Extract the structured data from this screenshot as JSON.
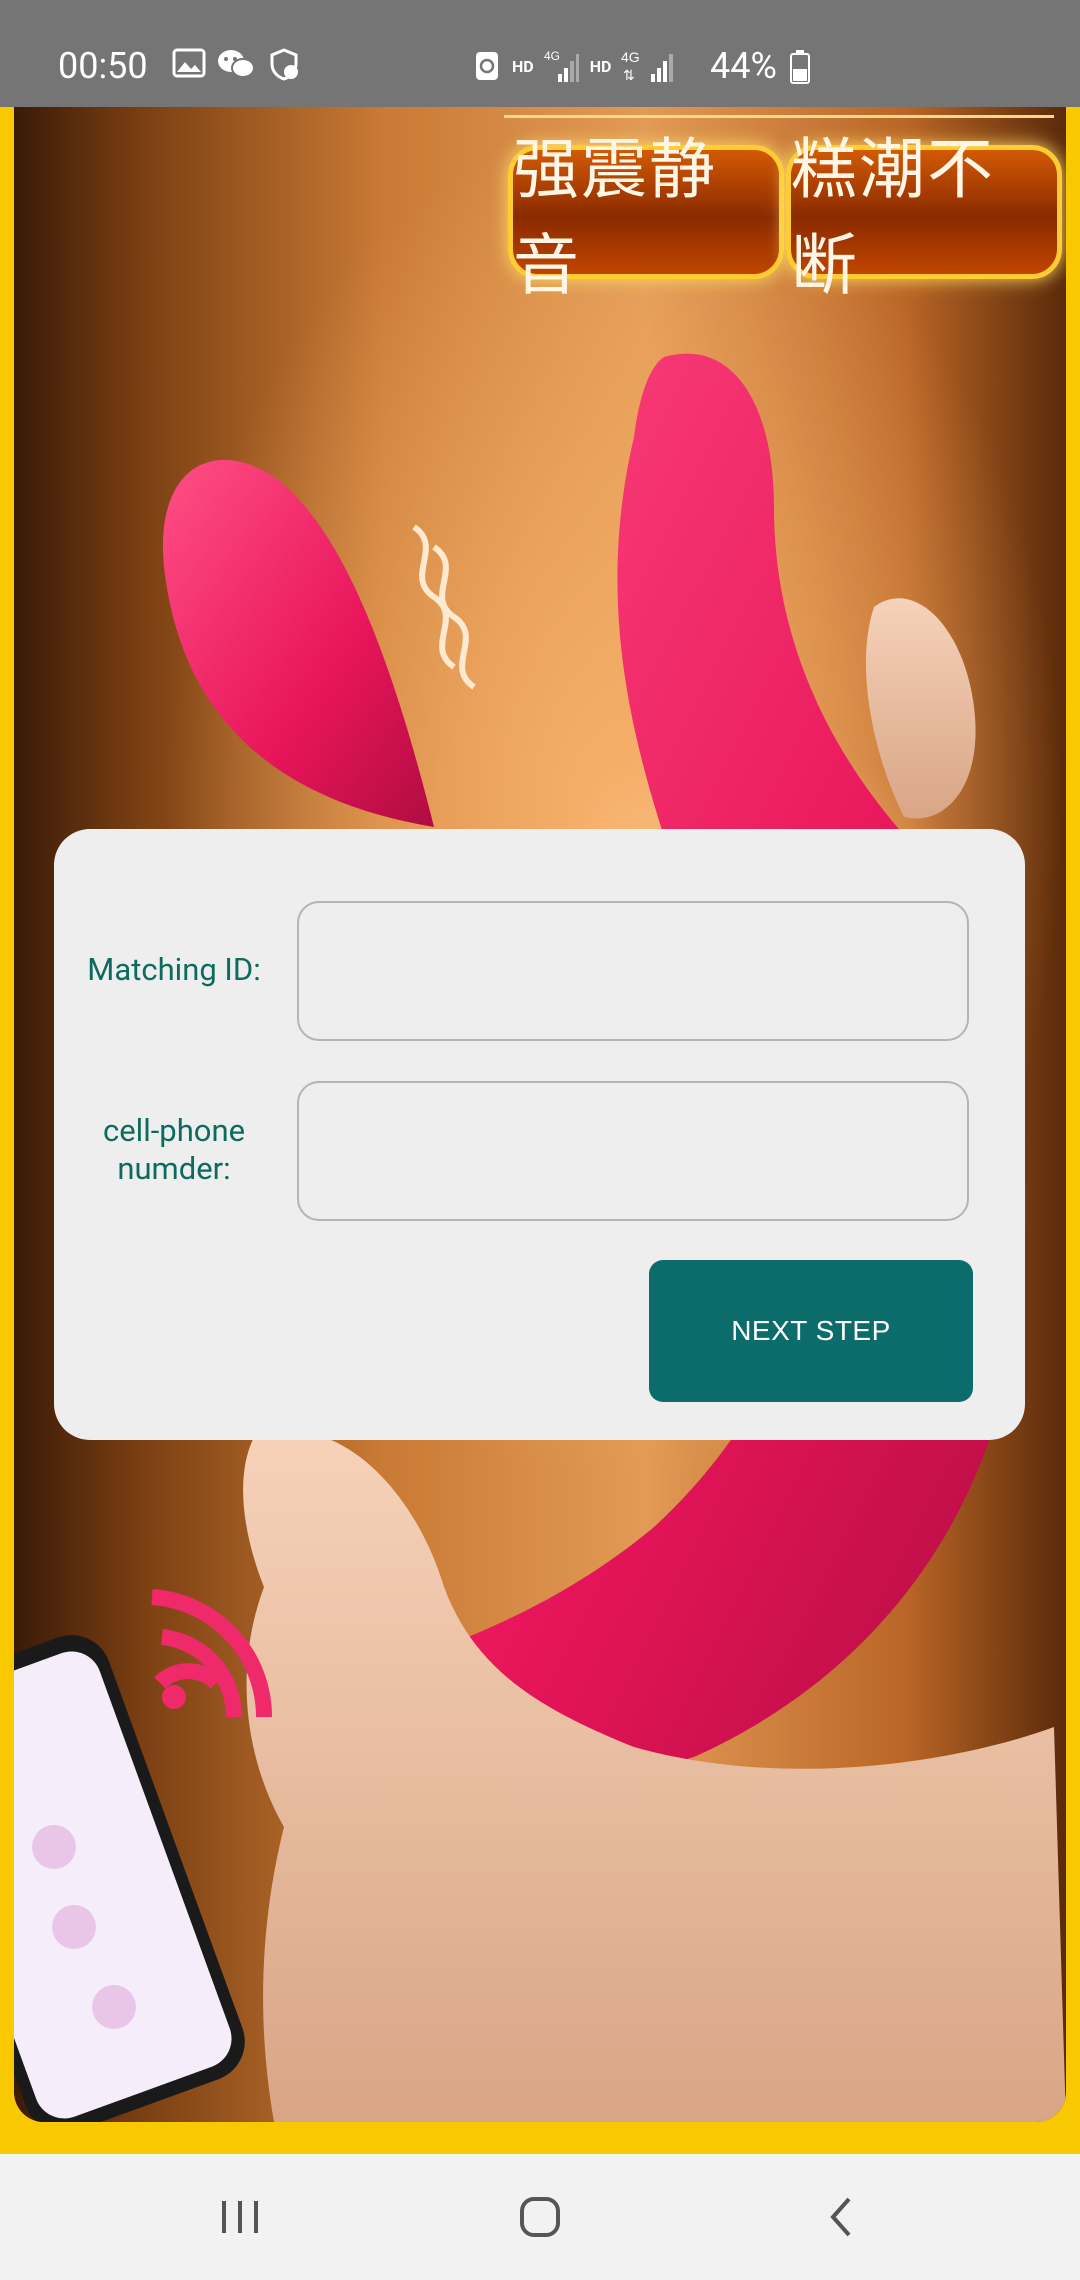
{
  "status_bar": {
    "time": "00:50",
    "network_labels": [
      "HD",
      "HD"
    ],
    "battery": "44%",
    "left_icons": [
      "gallery-icon",
      "wechat-icon",
      "shield-icon"
    ],
    "right_icons": [
      "recycle-icon",
      "signal-4g-icon",
      "signal-4g-icon",
      "battery-icon"
    ]
  },
  "promo": {
    "banners": [
      "强震静音",
      "糕潮不断"
    ],
    "border_color": "#f8c800",
    "product_color": "#ee1a5a"
  },
  "form": {
    "matching_id_label": "Matching ID:",
    "matching_id_value": "",
    "phone_label": "cell-phone numder:",
    "phone_value": "",
    "next_button": "NEXT STEP",
    "accent_color": "#0c6b6b"
  },
  "nav_bar": {
    "buttons": [
      "recent-apps-icon",
      "home-icon",
      "back-icon"
    ]
  }
}
